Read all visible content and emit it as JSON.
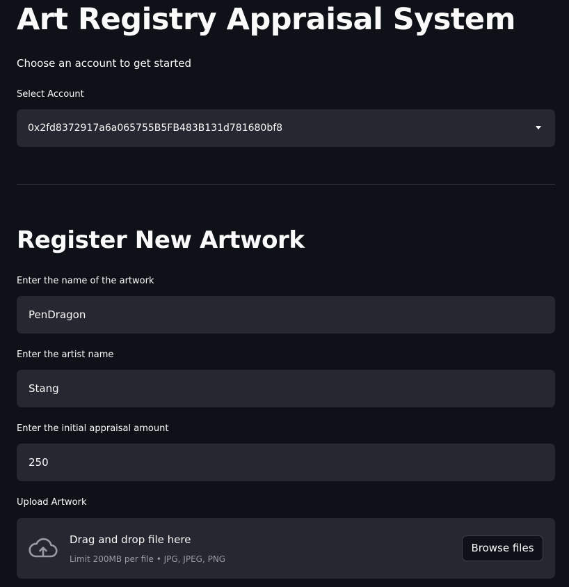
{
  "header": {
    "title": "Art Registry Appraisal System",
    "subtitle": "Choose an account to get started"
  },
  "account": {
    "label": "Select Account",
    "selected": "0x2fd8372917a6a065755B5FB483B131d781680bf8"
  },
  "register": {
    "title": "Register New Artwork",
    "name": {
      "label": "Enter the name of the artwork",
      "value": "PenDragon"
    },
    "artist": {
      "label": "Enter the artist name",
      "value": "Stang"
    },
    "appraisal": {
      "label": "Enter the initial appraisal amount",
      "value": "250"
    },
    "upload": {
      "label": "Upload Artwork",
      "drop_title": "Drag and drop file here",
      "hint": "Limit 200MB per file • JPG, JPEG, PNG",
      "browse_label": "Browse files",
      "icon": "cloud-upload-icon"
    }
  }
}
